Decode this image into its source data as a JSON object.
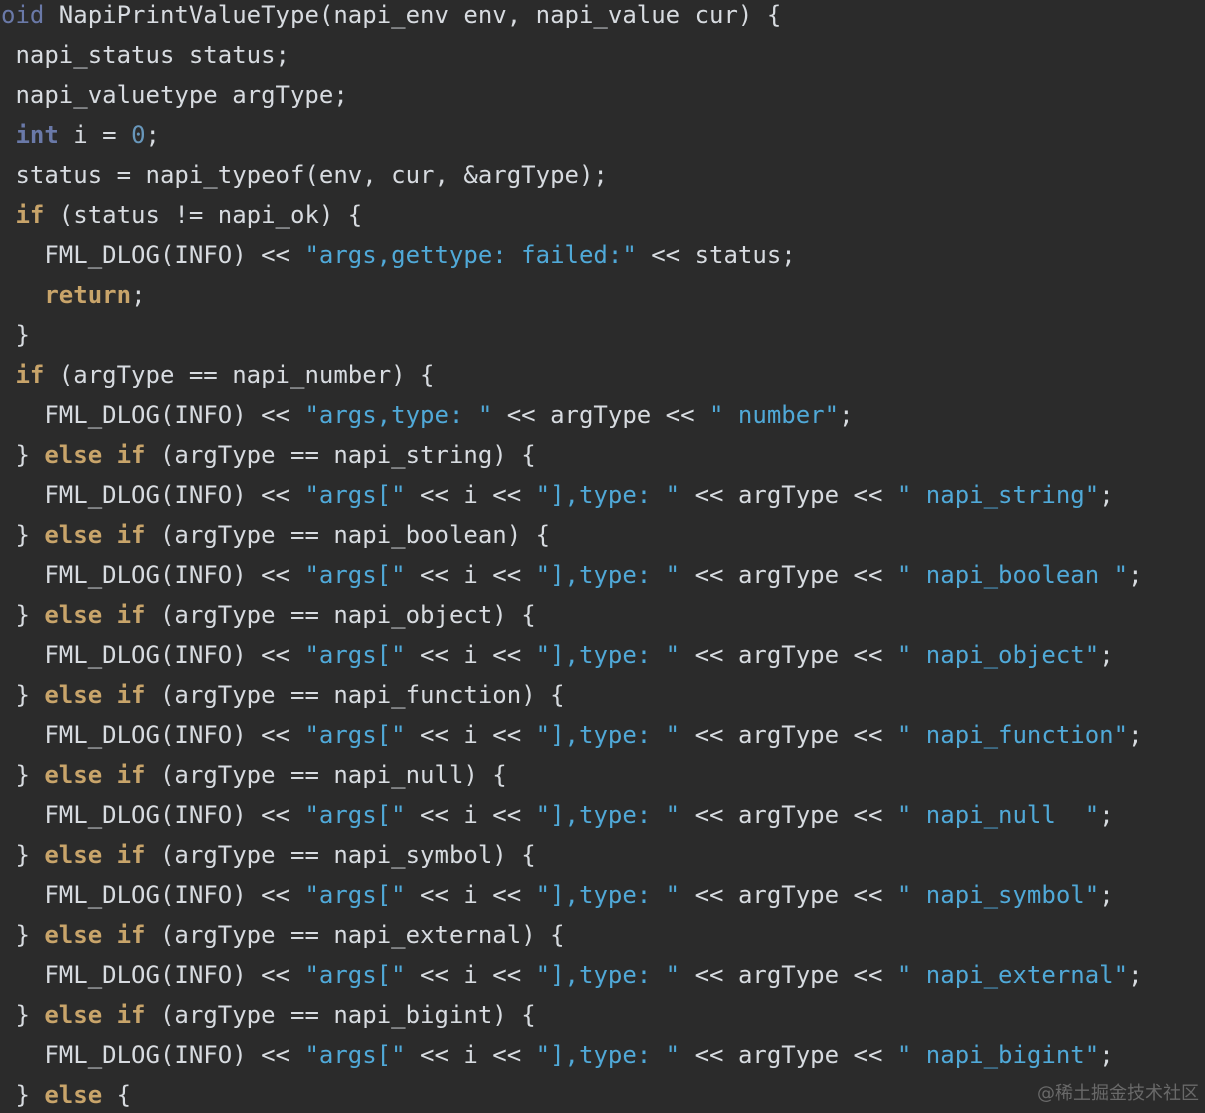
{
  "editor": {
    "lines": [
      [
        {
          "t": "oid",
          "c": "faded"
        },
        {
          "t": " NapiPrintValueType(napi_env env, napi_value cur) {",
          "c": "plain"
        }
      ],
      [
        {
          "t": " napi_status status;",
          "c": "plain"
        }
      ],
      [
        {
          "t": " napi_valuetype argType;",
          "c": "plain"
        }
      ],
      [
        {
          "t": " ",
          "c": "plain"
        },
        {
          "t": "int",
          "c": "type"
        },
        {
          "t": " i = ",
          "c": "plain"
        },
        {
          "t": "0",
          "c": "num"
        },
        {
          "t": ";",
          "c": "plain"
        }
      ],
      [
        {
          "t": " status = napi_typeof(env, cur, &argType);",
          "c": "plain"
        }
      ],
      [
        {
          "t": " ",
          "c": "plain"
        },
        {
          "t": "if",
          "c": "kw"
        },
        {
          "t": " (status != napi_ok) {",
          "c": "plain"
        }
      ],
      [
        {
          "t": "   FML_DLOG(INFO) << ",
          "c": "plain"
        },
        {
          "t": "\"args,gettype: failed:\"",
          "c": "str"
        },
        {
          "t": " << status;",
          "c": "plain"
        }
      ],
      [
        {
          "t": "   ",
          "c": "plain"
        },
        {
          "t": "return",
          "c": "kw"
        },
        {
          "t": ";",
          "c": "plain"
        }
      ],
      [
        {
          "t": " }",
          "c": "plain"
        }
      ],
      [
        {
          "t": " ",
          "c": "plain"
        },
        {
          "t": "if",
          "c": "kw"
        },
        {
          "t": " (argType == napi_number) {",
          "c": "plain"
        }
      ],
      [
        {
          "t": "   FML_DLOG(INFO) << ",
          "c": "plain"
        },
        {
          "t": "\"args,type: \"",
          "c": "str"
        },
        {
          "t": " << argType << ",
          "c": "plain"
        },
        {
          "t": "\" number\"",
          "c": "str"
        },
        {
          "t": ";",
          "c": "plain"
        }
      ],
      [
        {
          "t": " } ",
          "c": "plain"
        },
        {
          "t": "else if",
          "c": "kw"
        },
        {
          "t": " (argType == napi_string) {",
          "c": "plain"
        }
      ],
      [
        {
          "t": "   FML_DLOG(INFO) << ",
          "c": "plain"
        },
        {
          "t": "\"args[\"",
          "c": "str"
        },
        {
          "t": " << i << ",
          "c": "plain"
        },
        {
          "t": "\"],type: \"",
          "c": "str"
        },
        {
          "t": " << argType << ",
          "c": "plain"
        },
        {
          "t": "\" napi_string\"",
          "c": "str"
        },
        {
          "t": ";",
          "c": "plain"
        }
      ],
      [
        {
          "t": " } ",
          "c": "plain"
        },
        {
          "t": "else if",
          "c": "kw"
        },
        {
          "t": " (argType == napi_boolean) {",
          "c": "plain"
        }
      ],
      [
        {
          "t": "   FML_DLOG(INFO) << ",
          "c": "plain"
        },
        {
          "t": "\"args[\"",
          "c": "str"
        },
        {
          "t": " << i << ",
          "c": "plain"
        },
        {
          "t": "\"],type: \"",
          "c": "str"
        },
        {
          "t": " << argType << ",
          "c": "plain"
        },
        {
          "t": "\" napi_boolean \"",
          "c": "str"
        },
        {
          "t": ";",
          "c": "plain"
        }
      ],
      [
        {
          "t": " } ",
          "c": "plain"
        },
        {
          "t": "else if",
          "c": "kw"
        },
        {
          "t": " (argType == napi_object) {",
          "c": "plain"
        }
      ],
      [
        {
          "t": "   FML_DLOG(INFO) << ",
          "c": "plain"
        },
        {
          "t": "\"args[\"",
          "c": "str"
        },
        {
          "t": " << i << ",
          "c": "plain"
        },
        {
          "t": "\"],type: \"",
          "c": "str"
        },
        {
          "t": " << argType << ",
          "c": "plain"
        },
        {
          "t": "\" napi_object\"",
          "c": "str"
        },
        {
          "t": ";",
          "c": "plain"
        }
      ],
      [
        {
          "t": " } ",
          "c": "plain"
        },
        {
          "t": "else if",
          "c": "kw"
        },
        {
          "t": " (argType == napi_function) {",
          "c": "plain"
        }
      ],
      [
        {
          "t": "   FML_DLOG(INFO) << ",
          "c": "plain"
        },
        {
          "t": "\"args[\"",
          "c": "str"
        },
        {
          "t": " << i << ",
          "c": "plain"
        },
        {
          "t": "\"],type: \"",
          "c": "str"
        },
        {
          "t": " << argType << ",
          "c": "plain"
        },
        {
          "t": "\" napi_function\"",
          "c": "str"
        },
        {
          "t": ";",
          "c": "plain"
        }
      ],
      [
        {
          "t": " } ",
          "c": "plain"
        },
        {
          "t": "else if",
          "c": "kw"
        },
        {
          "t": " (argType == napi_null) {",
          "c": "plain"
        }
      ],
      [
        {
          "t": "   FML_DLOG(INFO) << ",
          "c": "plain"
        },
        {
          "t": "\"args[\"",
          "c": "str"
        },
        {
          "t": " << i << ",
          "c": "plain"
        },
        {
          "t": "\"],type: \"",
          "c": "str"
        },
        {
          "t": " << argType << ",
          "c": "plain"
        },
        {
          "t": "\" napi_null  \"",
          "c": "str"
        },
        {
          "t": ";",
          "c": "plain"
        }
      ],
      [
        {
          "t": " } ",
          "c": "plain"
        },
        {
          "t": "else if",
          "c": "kw"
        },
        {
          "t": " (argType == napi_symbol) {",
          "c": "plain"
        }
      ],
      [
        {
          "t": "   FML_DLOG(INFO) << ",
          "c": "plain"
        },
        {
          "t": "\"args[\"",
          "c": "str"
        },
        {
          "t": " << i << ",
          "c": "plain"
        },
        {
          "t": "\"],type: \"",
          "c": "str"
        },
        {
          "t": " << argType << ",
          "c": "plain"
        },
        {
          "t": "\" napi_symbol\"",
          "c": "str"
        },
        {
          "t": ";",
          "c": "plain"
        }
      ],
      [
        {
          "t": " } ",
          "c": "plain"
        },
        {
          "t": "else if",
          "c": "kw"
        },
        {
          "t": " (argType == napi_external) {",
          "c": "plain"
        }
      ],
      [
        {
          "t": "   FML_DLOG(INFO) << ",
          "c": "plain"
        },
        {
          "t": "\"args[\"",
          "c": "str"
        },
        {
          "t": " << i << ",
          "c": "plain"
        },
        {
          "t": "\"],type: \"",
          "c": "str"
        },
        {
          "t": " << argType << ",
          "c": "plain"
        },
        {
          "t": "\" napi_external\"",
          "c": "str"
        },
        {
          "t": ";",
          "c": "plain"
        }
      ],
      [
        {
          "t": " } ",
          "c": "plain"
        },
        {
          "t": "else if",
          "c": "kw"
        },
        {
          "t": " (argType == napi_bigint) {",
          "c": "plain"
        }
      ],
      [
        {
          "t": "   FML_DLOG(INFO) << ",
          "c": "plain"
        },
        {
          "t": "\"args[\"",
          "c": "str"
        },
        {
          "t": " << i << ",
          "c": "plain"
        },
        {
          "t": "\"],type: \"",
          "c": "str"
        },
        {
          "t": " << argType << ",
          "c": "plain"
        },
        {
          "t": "\" napi_bigint\"",
          "c": "str"
        },
        {
          "t": ";",
          "c": "plain"
        }
      ],
      [
        {
          "t": " } ",
          "c": "plain"
        },
        {
          "t": "else",
          "c": "kw"
        },
        {
          "t": " {",
          "c": "plain"
        }
      ]
    ]
  },
  "watermark": {
    "text": "@稀土掘金技术社区"
  },
  "colors": {
    "background": "#2b2b2b",
    "plain": "#d7dbe0",
    "keyword": "#c8a46a",
    "type": "#6a79a8",
    "string": "#50a9d8",
    "number": "#6897bb"
  }
}
